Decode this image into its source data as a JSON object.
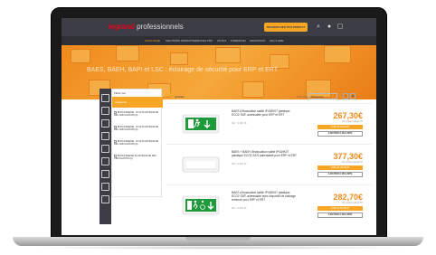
{
  "header": {
    "logo_brand": "legrand",
    "logo_suffix": "professionnels",
    "search_button": "RECHERCHER PAR PRODUIT"
  },
  "nav": {
    "items": [
      "CATALOGUE",
      "SOLUTIONS PRODUITS",
      "SERVICES PRO",
      "OUTILS",
      "FORMATION",
      "INNOVATION",
      "FAQ & AIDE"
    ],
    "active_index": 0
  },
  "hero": {
    "title": "BAES, BAEH, BAPI et LSC : éclairage de sécurité pour ERP et ERT"
  },
  "filters": {
    "header": "Filtrer par",
    "selected": "Catégorie",
    "items": [
      "BLOCS BAES/E - IP 43 PLASTIQUE DE DEV CIRCULATION (3)",
      "BLOCS BAES/E - IP 42 PLASTIQUE DE DEV CIRCULATION (3)",
      "BLOCS BAES/E - IP 42 PLASTIQUE DE DEV CIRCULATION (3)",
      "BLOCS BAES/E PLASTIQUE DE DEV CIRCULATION (3)"
    ]
  },
  "results": {
    "count": "14",
    "count_label": "produits",
    "sort_label": "Trier par",
    "sort_value": "Pertinence"
  },
  "products": [
    {
      "title": "BAES d'évacuation saillie IP43/IK07 plastique ECO2 SATI adressable pour ERP et ERT",
      "ref": "Réf. : 0 626 28",
      "price": "267,30€",
      "price_note": "Prix public indicatif HT",
      "btn_primary": "VOIR LE PRODUIT",
      "btn_secondary": "AJOUTER À MA LISTE",
      "image_type": "exit-sign-running-man"
    },
    {
      "title": "BAES + BAEH d'évacuation saillie IP43/IK07 plastique ECO2 SATI adressable pour ERP et ERT",
      "ref": "Réf. : 0 626 32",
      "price": "377,30€",
      "price_note": "Prix public indicatif HT",
      "btn_primary": "VOIR LE PRODUIT",
      "btn_secondary": "AJOUTER À MA LISTE",
      "image_type": "blank-lamp"
    },
    {
      "title": "BAES d'évacuation saillie IP43/IK07 plastique ECO2 SATI adressable avec dispositif de balisage renforcé pour ERP et ERT",
      "ref": "Réf. : 0 626 34",
      "price": "282,70€",
      "price_note": "Prix public indicatif HT",
      "btn_primary": "VOIR LE PRODUIT",
      "btn_secondary": "AJOUTER À MA LISTE",
      "image_type": "exit-sign-accessible"
    }
  ],
  "colors": {
    "accent": "#f6a623",
    "price": "#f08a1c",
    "dark_header": "#3d3d45",
    "sign_green": "#1e9a3b"
  }
}
